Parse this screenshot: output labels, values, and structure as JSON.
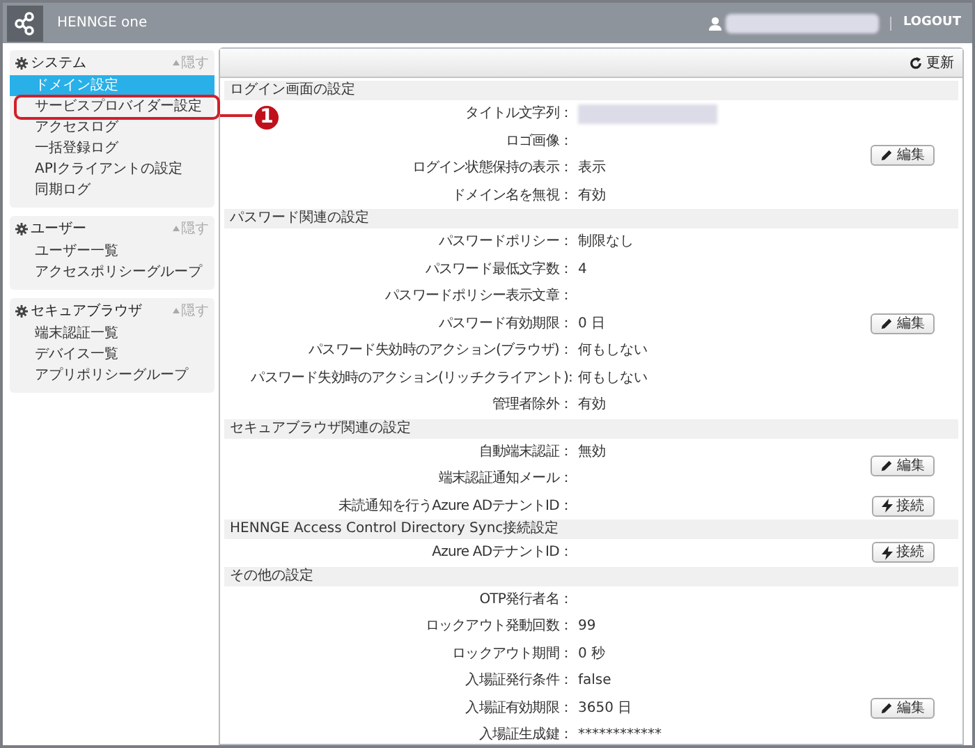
{
  "header": {
    "app_name": "HENNGE one",
    "logout": "LOGOUT"
  },
  "sidebar": [
    {
      "title": "システム",
      "collapse": "隠す",
      "items": [
        {
          "label": "ドメイン設定",
          "selected": true
        },
        {
          "label": "サービスプロバイダー設定",
          "selected": false
        },
        {
          "label": "アクセスログ",
          "selected": false
        },
        {
          "label": "一括登録ログ",
          "selected": false
        },
        {
          "label": "APIクライアントの設定",
          "selected": false
        },
        {
          "label": "同期ログ",
          "selected": false
        }
      ]
    },
    {
      "title": "ユーザー",
      "collapse": "隠す",
      "items": [
        {
          "label": "ユーザー一覧",
          "selected": false
        },
        {
          "label": "アクセスポリシーグループ",
          "selected": false
        }
      ]
    },
    {
      "title": "セキュアブラウザ",
      "collapse": "隠す",
      "items": [
        {
          "label": "端末認証一覧",
          "selected": false
        },
        {
          "label": "デバイス一覧",
          "selected": false
        },
        {
          "label": "アプリポリシーグループ",
          "selected": false
        }
      ]
    }
  ],
  "annotation": {
    "number": "1"
  },
  "toolbar": {
    "refresh": "更新"
  },
  "sections": [
    {
      "title": "ログイン画面の設定",
      "groups": [
        {
          "action": {
            "kind": "edit",
            "label": "編集"
          },
          "rows": [
            {
              "label": "タイトル文字列：",
              "kind": "redacted"
            },
            {
              "label": "ロゴ画像：",
              "value": ""
            },
            {
              "label": "ログイン状態保持の表示：",
              "value": "表示"
            },
            {
              "label": "ドメイン名を無視：",
              "value": "有効"
            }
          ]
        }
      ]
    },
    {
      "title": "パスワード関連の設定",
      "groups": [
        {
          "action": {
            "kind": "edit",
            "label": "編集"
          },
          "rows": [
            {
              "label": "パスワードポリシー：",
              "value": "制限なし"
            },
            {
              "label": "パスワード最低文字数：",
              "value": "4"
            },
            {
              "label": "パスワードポリシー表示文章：",
              "value": ""
            },
            {
              "label": "パスワード有効期限：",
              "value": "0 日"
            },
            {
              "label": "パスワード失効時のアクション(ブラウザ)：",
              "value": "何もしない"
            },
            {
              "label": "パスワード失効時のアクション(リッチクライアント):",
              "value": "何もしない"
            },
            {
              "label": "管理者除外：",
              "value": "有効"
            }
          ]
        }
      ]
    },
    {
      "title": "セキュアブラウザ関連の設定",
      "groups": [
        {
          "action": {
            "kind": "edit",
            "label": "編集"
          },
          "rows": [
            {
              "label": "自動端末認証：",
              "value": "無効"
            },
            {
              "label": "端末認証通知メール：",
              "value": ""
            }
          ]
        },
        {
          "action": {
            "kind": "connect",
            "label": "接続"
          },
          "rows": [
            {
              "label": "未読通知を行うAzure ADテナントID：",
              "value": ""
            }
          ]
        }
      ]
    },
    {
      "title": "HENNGE Access Control Directory Sync接続設定",
      "groups": [
        {
          "action": {
            "kind": "connect",
            "label": "接続"
          },
          "rows": [
            {
              "label": "Azure ADテナントID：",
              "value": ""
            }
          ]
        }
      ]
    },
    {
      "title": "その他の設定",
      "groups": [
        {
          "rows": [
            {
              "label": "OTP発行者名：",
              "value": ""
            },
            {
              "label": "ロックアウト発動回数：",
              "value": "99"
            },
            {
              "label": "ロックアウト期間：",
              "value": "0 秒"
            },
            {
              "label": "入場証発行条件：",
              "value": "false"
            }
          ]
        },
        {
          "action": {
            "kind": "edit",
            "label": "編集"
          },
          "rows": [
            {
              "label": "入場証有効期限：",
              "value": "3650 日"
            }
          ]
        },
        {
          "rows": [
            {
              "label": "入場証生成鍵：",
              "value": "************"
            }
          ]
        }
      ]
    }
  ]
}
